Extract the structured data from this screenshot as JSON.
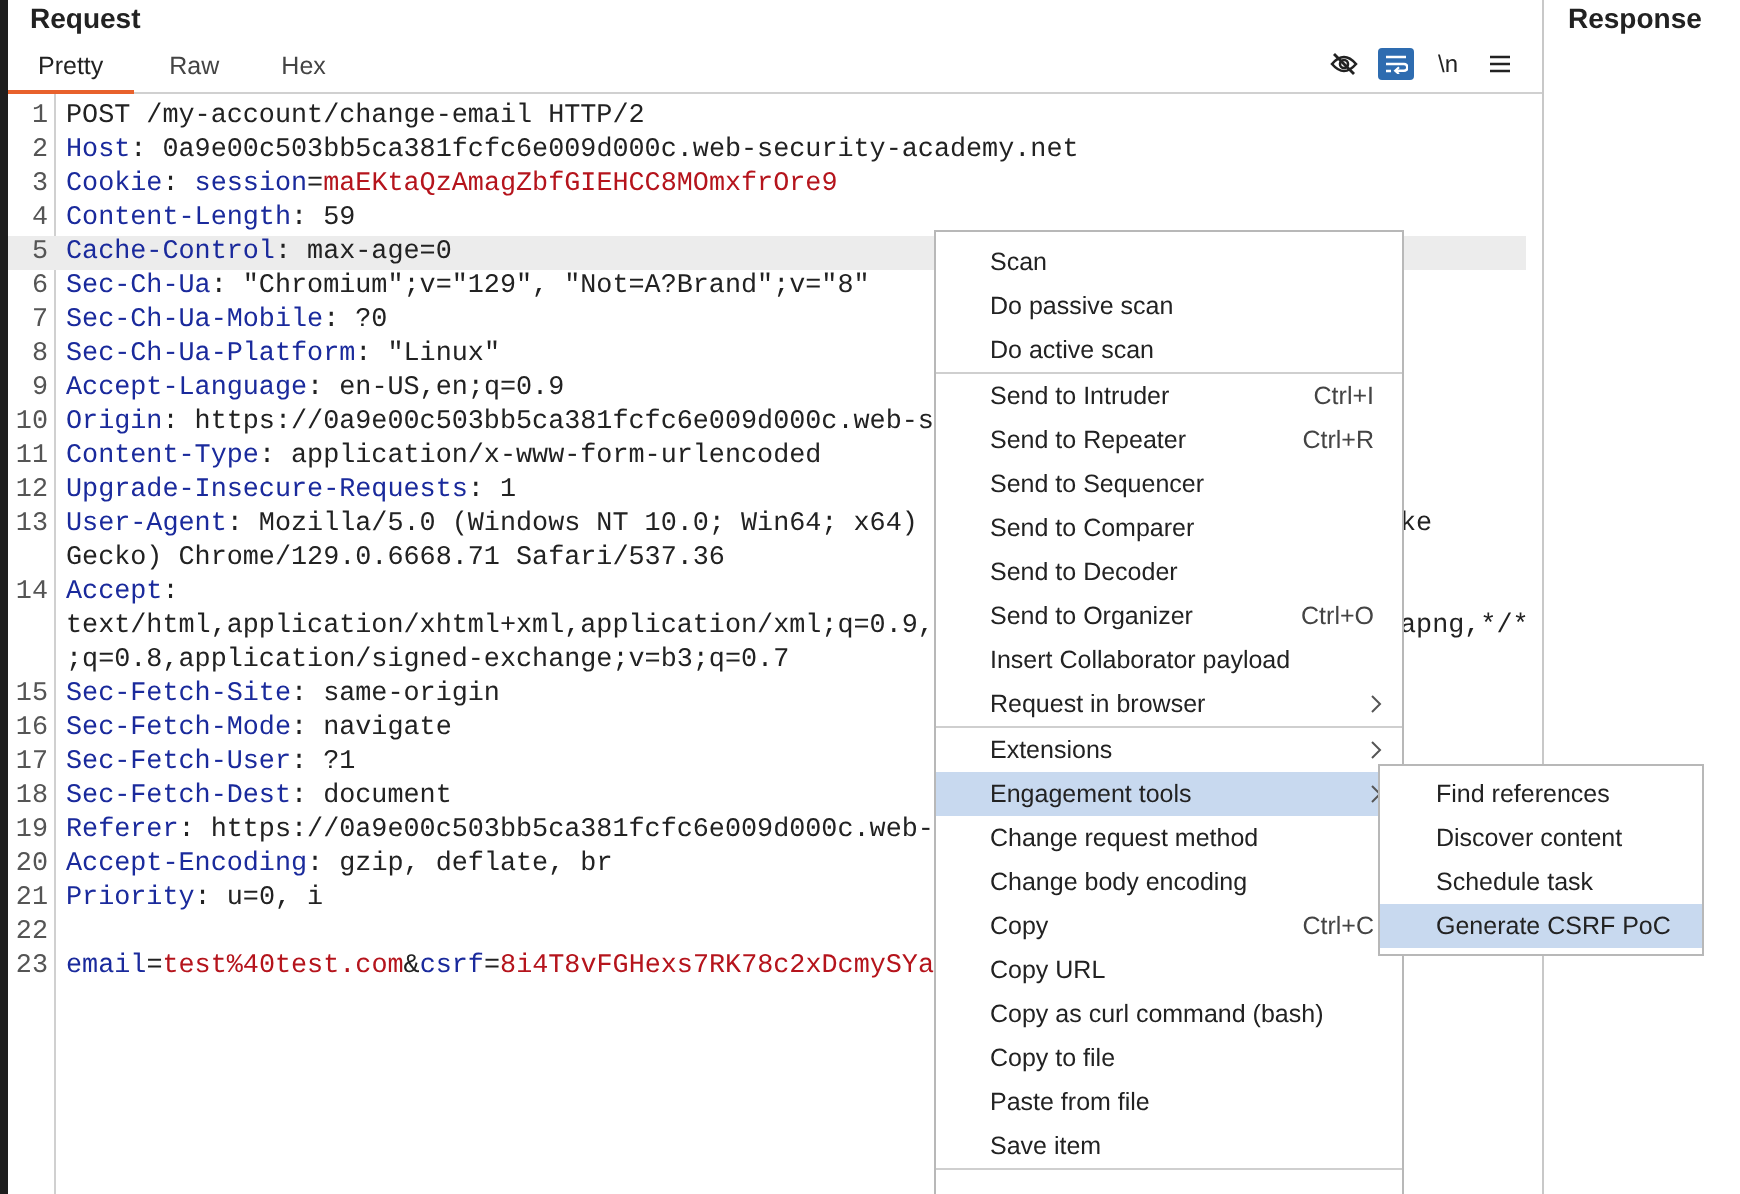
{
  "request": {
    "title": "Request",
    "tabs": [
      {
        "label": "Pretty",
        "selected": true
      },
      {
        "label": "Raw",
        "selected": false
      },
      {
        "label": "Hex",
        "selected": false
      }
    ],
    "toolbar": [
      {
        "kind": "hide",
        "selected": false
      },
      {
        "kind": "wrap",
        "selected": true
      },
      {
        "kind": "text",
        "label": "\\n",
        "selected": false
      },
      {
        "kind": "menu",
        "selected": false
      }
    ],
    "lines": [
      {
        "number": "1",
        "highlighted": false,
        "rows": [
          {
            "parts": [
              {
                "kind": "plain",
                "text": "POST /my-account/change-email HTTP/2"
              }
            ]
          }
        ]
      },
      {
        "number": "2",
        "highlighted": false,
        "rows": [
          {
            "parts": [
              {
                "kind": "name",
                "text": "Host"
              },
              {
                "kind": "plain",
                "text": ": 0a9e00c503bb5ca381fcfc6e009d000c.web-security-academy.net"
              }
            ]
          }
        ]
      },
      {
        "number": "3",
        "highlighted": false,
        "rows": [
          {
            "parts": [
              {
                "kind": "name",
                "text": "Cookie"
              },
              {
                "kind": "plain",
                "text": ": "
              },
              {
                "kind": "name",
                "text": "session"
              },
              {
                "kind": "plain",
                "text": "="
              },
              {
                "kind": "param",
                "text": "maEKtaQzAmagZbfGIEHCC8MOmxfrOre9"
              }
            ]
          }
        ]
      },
      {
        "number": "4",
        "highlighted": false,
        "rows": [
          {
            "parts": [
              {
                "kind": "name",
                "text": "Content-Length"
              },
              {
                "kind": "plain",
                "text": ": 59"
              }
            ]
          }
        ]
      },
      {
        "number": "5",
        "highlighted": true,
        "rows": [
          {
            "parts": [
              {
                "kind": "name",
                "text": "Cache-Control"
              },
              {
                "kind": "plain",
                "text": ": max-age=0"
              }
            ]
          }
        ]
      },
      {
        "number": "6",
        "highlighted": false,
        "rows": [
          {
            "parts": [
              {
                "kind": "name",
                "text": "Sec-Ch-Ua"
              },
              {
                "kind": "plain",
                "text": ": \"Chromium\";v=\"129\", \"Not=A?Brand\";v=\"8\""
              }
            ]
          }
        ]
      },
      {
        "number": "7",
        "highlighted": false,
        "rows": [
          {
            "parts": [
              {
                "kind": "name",
                "text": "Sec-Ch-Ua-Mobile"
              },
              {
                "kind": "plain",
                "text": ": ?0"
              }
            ]
          }
        ]
      },
      {
        "number": "8",
        "highlighted": false,
        "rows": [
          {
            "parts": [
              {
                "kind": "name",
                "text": "Sec-Ch-Ua-Platform"
              },
              {
                "kind": "plain",
                "text": ": \"Linux\""
              }
            ]
          }
        ]
      },
      {
        "number": "9",
        "highlighted": false,
        "rows": [
          {
            "parts": [
              {
                "kind": "name",
                "text": "Accept-Language"
              },
              {
                "kind": "plain",
                "text": ": en-US,en;q=0.9"
              }
            ]
          }
        ]
      },
      {
        "number": "10",
        "highlighted": false,
        "rows": [
          {
            "parts": [
              {
                "kind": "name",
                "text": "Origin"
              },
              {
                "kind": "plain",
                "text": ": https://0a9e00c503bb5ca381fcfc6e009d000c.web-s"
              }
            ]
          }
        ]
      },
      {
        "number": "11",
        "highlighted": false,
        "rows": [
          {
            "parts": [
              {
                "kind": "name",
                "text": "Content-Type"
              },
              {
                "kind": "plain",
                "text": ": application/x-www-form-urlencoded"
              }
            ]
          }
        ]
      },
      {
        "number": "12",
        "highlighted": false,
        "rows": [
          {
            "parts": [
              {
                "kind": "name",
                "text": "Upgrade-Insecure-Requests"
              },
              {
                "kind": "plain",
                "text": ": 1"
              }
            ]
          }
        ]
      },
      {
        "number": "13",
        "highlighted": false,
        "rows": [
          {
            "parts": [
              {
                "kind": "name",
                "text": "User-Agent"
              },
              {
                "kind": "plain",
                "text": ": Mozilla/5.0 (Windows NT 10.0; Win64; x64)"
              }
            ],
            "tail": "ke"
          },
          {
            "parts": [
              {
                "kind": "plain",
                "text": "Gecko) Chrome/129.0.6668.71 Safari/537.36"
              }
            ]
          }
        ]
      },
      {
        "number": "14",
        "highlighted": false,
        "rows": [
          {
            "parts": [
              {
                "kind": "name",
                "text": "Accept"
              },
              {
                "kind": "plain",
                "text": ":"
              }
            ]
          },
          {
            "parts": [
              {
                "kind": "plain",
                "text": "text/html,application/xhtml+xml,application/xml;q=0.9,"
              }
            ],
            "tail": "apng,*/*"
          },
          {
            "parts": [
              {
                "kind": "plain",
                "text": ";q=0.8,application/signed-exchange;v=b3;q=0.7"
              }
            ]
          }
        ]
      },
      {
        "number": "15",
        "highlighted": false,
        "rows": [
          {
            "parts": [
              {
                "kind": "name",
                "text": "Sec-Fetch-Site"
              },
              {
                "kind": "plain",
                "text": ": same-origin"
              }
            ]
          }
        ]
      },
      {
        "number": "16",
        "highlighted": false,
        "rows": [
          {
            "parts": [
              {
                "kind": "name",
                "text": "Sec-Fetch-Mode"
              },
              {
                "kind": "plain",
                "text": ": navigate"
              }
            ]
          }
        ]
      },
      {
        "number": "17",
        "highlighted": false,
        "rows": [
          {
            "parts": [
              {
                "kind": "name",
                "text": "Sec-Fetch-User"
              },
              {
                "kind": "plain",
                "text": ": ?1"
              }
            ]
          }
        ]
      },
      {
        "number": "18",
        "highlighted": false,
        "rows": [
          {
            "parts": [
              {
                "kind": "name",
                "text": "Sec-Fetch-Dest"
              },
              {
                "kind": "plain",
                "text": ": document"
              }
            ]
          }
        ]
      },
      {
        "number": "19",
        "highlighted": false,
        "rows": [
          {
            "parts": [
              {
                "kind": "name",
                "text": "Referer"
              },
              {
                "kind": "plain",
                "text": ": https://0a9e00c503bb5ca381fcfc6e009d000c.web-"
              }
            ]
          }
        ]
      },
      {
        "number": "20",
        "highlighted": false,
        "rows": [
          {
            "parts": [
              {
                "kind": "name",
                "text": "Accept-Encoding"
              },
              {
                "kind": "plain",
                "text": ": gzip, deflate, br"
              }
            ]
          }
        ]
      },
      {
        "number": "21",
        "highlighted": false,
        "rows": [
          {
            "parts": [
              {
                "kind": "name",
                "text": "Priority"
              },
              {
                "kind": "plain",
                "text": ": u=0, i"
              }
            ]
          }
        ]
      },
      {
        "number": "22",
        "highlighted": false,
        "rows": [
          {
            "parts": []
          }
        ]
      },
      {
        "number": "23",
        "highlighted": false,
        "rows": [
          {
            "parts": [
              {
                "kind": "name",
                "text": "email"
              },
              {
                "kind": "plain",
                "text": "="
              },
              {
                "kind": "param",
                "text": "test%40test.com"
              },
              {
                "kind": "plain",
                "text": "&"
              },
              {
                "kind": "name",
                "text": "csrf"
              },
              {
                "kind": "plain",
                "text": "="
              },
              {
                "kind": "param",
                "text": "8i4T8vFGHexs7RK78c2xDcmySYa"
              }
            ]
          }
        ]
      }
    ]
  },
  "response": {
    "title": "Response"
  },
  "context_menu": {
    "items": [
      {
        "kind": "item",
        "label": "Scan",
        "selected": false
      },
      {
        "kind": "item",
        "label": "Do passive scan",
        "selected": false
      },
      {
        "kind": "item",
        "label": "Do active scan",
        "selected": false
      },
      {
        "kind": "separator"
      },
      {
        "kind": "item",
        "label": "Send to Intruder",
        "shortcut": "Ctrl+I",
        "selected": false
      },
      {
        "kind": "item",
        "label": "Send to Repeater",
        "shortcut": "Ctrl+R",
        "selected": false
      },
      {
        "kind": "item",
        "label": "Send to Sequencer",
        "selected": false
      },
      {
        "kind": "item",
        "label": "Send to Comparer",
        "selected": false
      },
      {
        "kind": "item",
        "label": "Send to Decoder",
        "selected": false
      },
      {
        "kind": "item",
        "label": "Send to Organizer",
        "shortcut": "Ctrl+O",
        "selected": false
      },
      {
        "kind": "item",
        "label": "Insert Collaborator payload",
        "selected": false
      },
      {
        "kind": "submenu",
        "label": "Request in browser",
        "selected": false
      },
      {
        "kind": "separator"
      },
      {
        "kind": "submenu",
        "label": "Extensions",
        "selected": false
      },
      {
        "kind": "submenu",
        "label": "Engagement tools",
        "selected": true
      },
      {
        "kind": "item",
        "label": "Change request method",
        "selected": false
      },
      {
        "kind": "item",
        "label": "Change body encoding",
        "selected": false
      },
      {
        "kind": "item",
        "label": "Copy",
        "shortcut": "Ctrl+C",
        "selected": false
      },
      {
        "kind": "item",
        "label": "Copy URL",
        "selected": false
      },
      {
        "kind": "item",
        "label": "Copy as curl command (bash)",
        "selected": false
      },
      {
        "kind": "item",
        "label": "Copy to file",
        "selected": false
      },
      {
        "kind": "item",
        "label": "Paste from file",
        "selected": false
      },
      {
        "kind": "item",
        "label": "Save item",
        "selected": false
      },
      {
        "kind": "separator"
      }
    ],
    "submenu": [
      {
        "label": "Find references",
        "selected": false
      },
      {
        "label": "Discover content",
        "selected": false
      },
      {
        "label": "Schedule task",
        "selected": false
      },
      {
        "label": "Generate CSRF PoC",
        "selected": true
      }
    ]
  }
}
